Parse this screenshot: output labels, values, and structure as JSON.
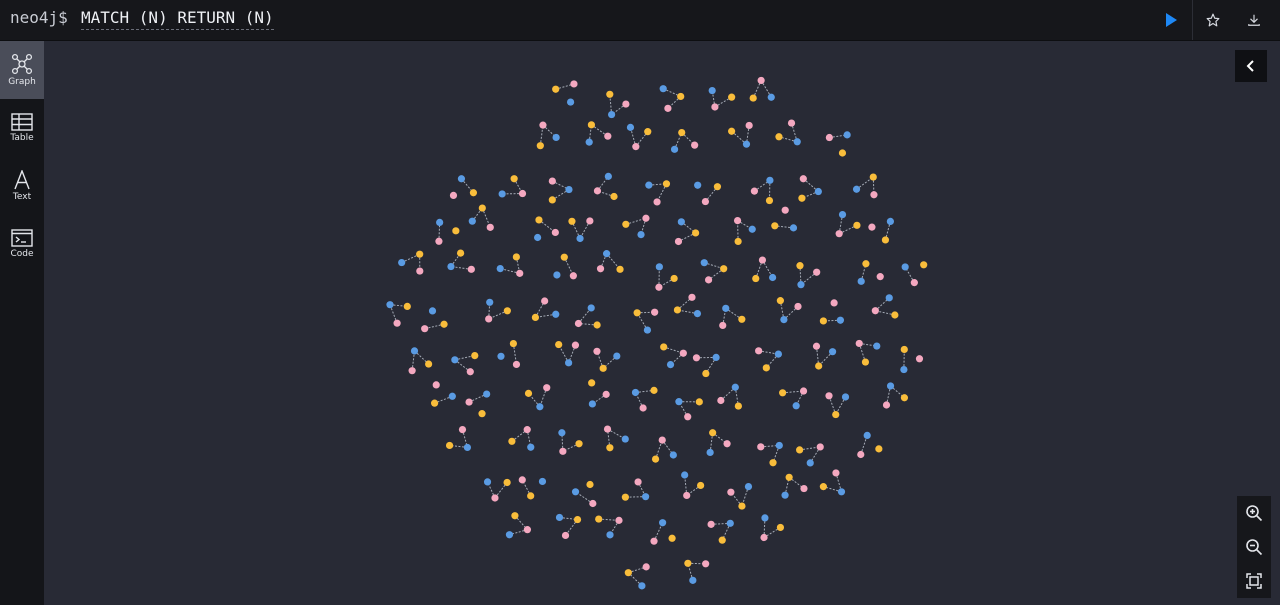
{
  "editor": {
    "prompt": "neo4j$",
    "query": "MATCH (N) RETURN (N)",
    "run_icon": "play-icon",
    "favorite_icon": "star-icon",
    "download_icon": "download-icon"
  },
  "sidebar": {
    "items": [
      {
        "label": "Graph",
        "icon": "graph-icon",
        "active": true
      },
      {
        "label": "Table",
        "icon": "table-icon",
        "active": false
      },
      {
        "label": "Text",
        "icon": "text-icon",
        "active": false
      },
      {
        "label": "Code",
        "icon": "code-icon",
        "active": false
      }
    ]
  },
  "graph": {
    "node_colors": {
      "label_a": "#f9bd3b",
      "label_b": "#f4a8c0",
      "label_c": "#5a9be3"
    },
    "relationship_color": "#a5abb6",
    "background": "#282a35"
  },
  "controls": {
    "collapse_icon": "chevron-left-icon",
    "zoom_in_icon": "zoom-in-icon",
    "zoom_out_icon": "zoom-out-icon",
    "fit_icon": "fit-to-screen-icon"
  }
}
